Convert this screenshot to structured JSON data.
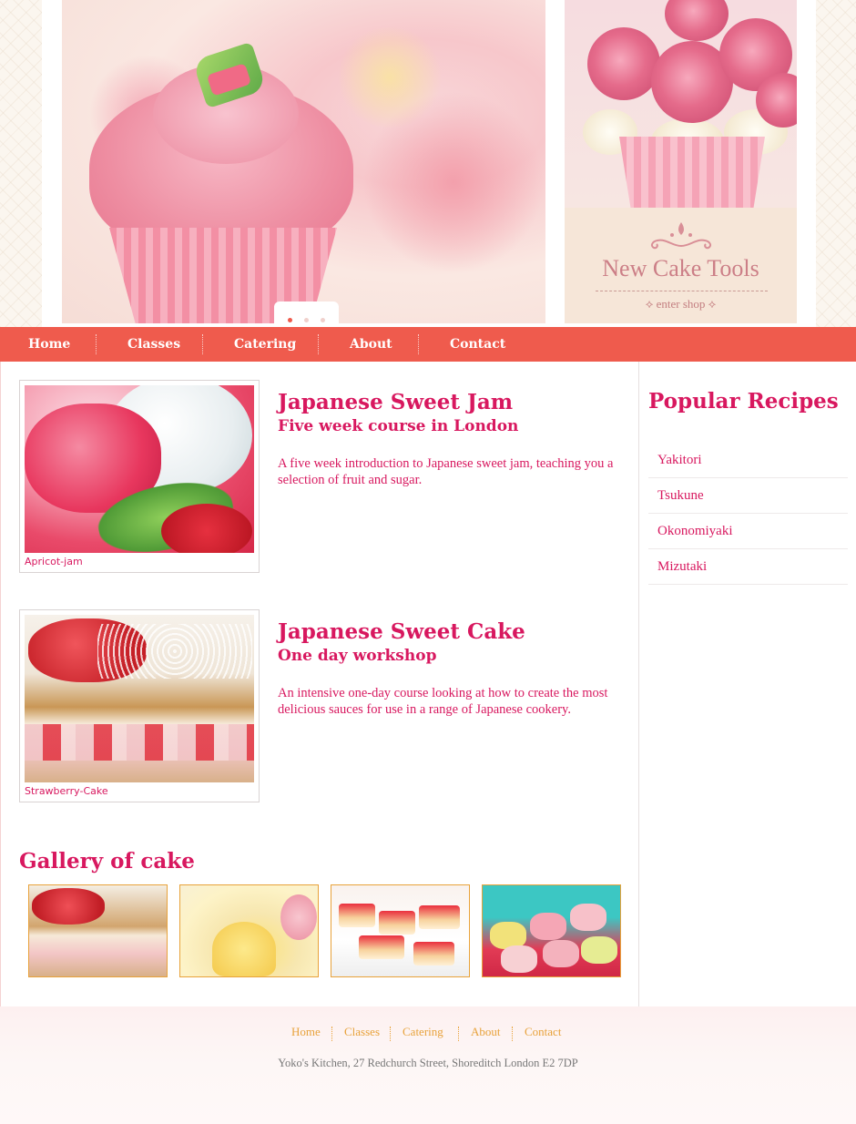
{
  "hero": {
    "slider_dots": 3,
    "slider_active_index": 0,
    "promo": {
      "title": "New Cake Tools",
      "link": "enter shop"
    }
  },
  "nav": {
    "items": [
      {
        "label": "Home"
      },
      {
        "label": "Classes"
      },
      {
        "label": "Catering"
      },
      {
        "label": "About"
      },
      {
        "label": "Contact"
      }
    ]
  },
  "courses": [
    {
      "title": "Japanese Sweet Jam",
      "subtitle": "Five week course in London",
      "description": "A five week introduction to Japanese sweet jam, teaching you a selection of fruit and sugar.",
      "image_caption": "Apricot-jam"
    },
    {
      "title": "Japanese Sweet Cake",
      "subtitle": "One day workshop",
      "description": "An intensive one-day course looking at how to create the most delicious sauces for use in a range of Japanese cookery.",
      "image_caption": "Strawberry-Cake"
    }
  ],
  "gallery": {
    "title": "Gallery of cake"
  },
  "sidebar": {
    "title": "Popular Recipes",
    "recipes": [
      {
        "label": "Yakitori"
      },
      {
        "label": "Tsukune"
      },
      {
        "label": "Okonomiyaki"
      },
      {
        "label": "Mizutaki"
      }
    ]
  },
  "footer": {
    "nav": [
      {
        "label": "Home"
      },
      {
        "label": "Classes"
      },
      {
        "label": "Catering"
      },
      {
        "label": "About"
      },
      {
        "label": "Contact"
      }
    ],
    "address": "Yoko's Kitchen, 27 Redchurch Street, Shoreditch London E2 7DP"
  },
  "colors": {
    "nav_bg": "#ef5b4d",
    "heading": "#d8185f",
    "footer_link": "#e8a23a"
  }
}
